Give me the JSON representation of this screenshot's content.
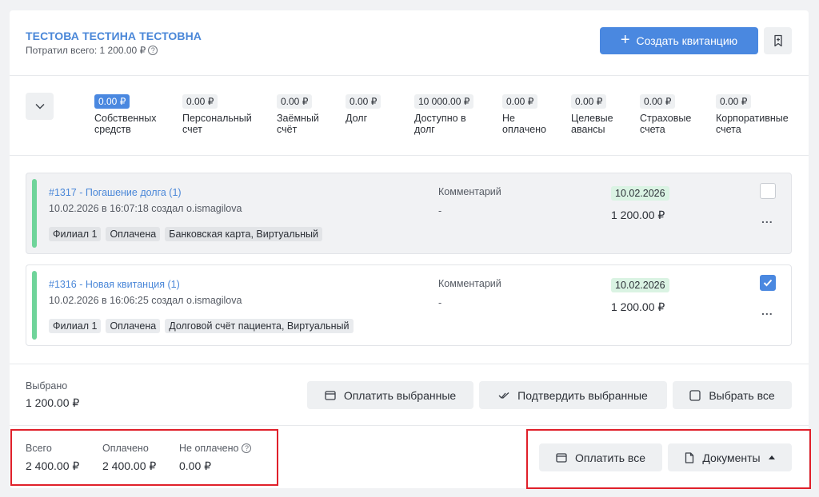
{
  "header": {
    "patient_name": "ТЕСТОВА ТЕСТИНА ТЕСТОВНА",
    "spent_text": "Потратил всего: 1 200.00 ₽",
    "create_button": "Создать квитанцию",
    "icons": {
      "help": "help-circle-icon",
      "create": "plus-icon",
      "bookmark": "bookmark-icon"
    }
  },
  "balances": [
    {
      "value": "0.00 ₽",
      "label": "Собственных\nсредств",
      "active": true
    },
    {
      "value": "0.00 ₽",
      "label": "Персональный\nсчет"
    },
    {
      "value": "0.00 ₽",
      "label": "Заёмный\nсчёт"
    },
    {
      "value": "0.00 ₽",
      "label": "Долг"
    },
    {
      "value": "10 000.00 ₽",
      "label": "Доступно в\nдолг"
    },
    {
      "value": "0.00 ₽",
      "label": "Не\nоплачено"
    },
    {
      "value": "0.00 ₽",
      "label": "Целевые\nавансы"
    },
    {
      "value": "0.00 ₽",
      "label": "Страховые\nсчета"
    },
    {
      "value": "0.00 ₽",
      "label": "Корпоративные\nсчета"
    }
  ],
  "receipts": [
    {
      "title": "#1317 - Погашение долга (1)",
      "subtitle": "10.02.2026 в 16:07:18 создал o.ismagilova",
      "tags": [
        "Филиал 1",
        "Оплачена",
        "Банковская карта, Виртуальный"
      ],
      "comment_label": "Комментарий",
      "comment_value": "-",
      "date": "10.02.2026",
      "amount": "1 200.00 ₽",
      "checked": false,
      "menu": "..."
    },
    {
      "title": "#1316 - Новая квитанция (1)",
      "subtitle": "10.02.2026 в 16:06:25 создал o.ismagilova",
      "tags": [
        "Филиал 1",
        "Оплачена",
        "Долговой счёт пациента, Виртуальный"
      ],
      "comment_label": "Комментарий",
      "comment_value": "-",
      "date": "10.02.2026",
      "amount": "1 200.00 ₽",
      "checked": true,
      "menu": "..."
    }
  ],
  "selected": {
    "label": "Выбрано",
    "value": "1 200.00 ₽",
    "pay_selected": "Оплатить выбранные",
    "confirm_selected": "Подтвердить выбранные",
    "select_all": "Выбрать все"
  },
  "totals": {
    "total_label": "Всего",
    "total_value": "2 400.00 ₽",
    "paid_label": "Оплачено",
    "paid_value": "2 400.00 ₽",
    "unpaid_label": "Не оплачено",
    "unpaid_value": "0.00 ₽",
    "pay_all": "Оплатить все",
    "documents": "Документы"
  },
  "colors": {
    "accent": "#4a88e0",
    "link": "#4a87d8",
    "stripe": "#6fd49a",
    "highlight": "#e0202a"
  }
}
